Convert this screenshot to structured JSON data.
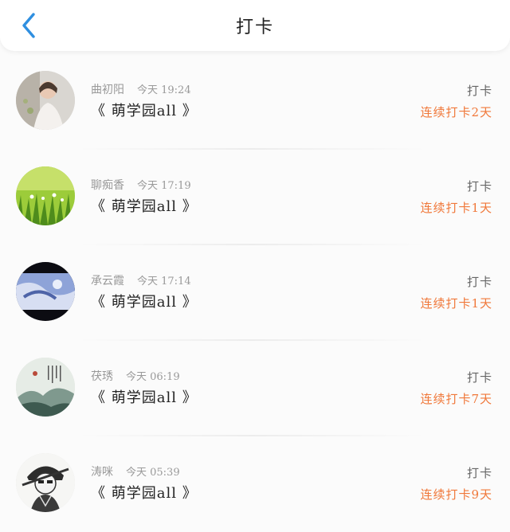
{
  "header": {
    "title": "打卡",
    "back_icon": "chevron-left-icon",
    "accent_color": "#2f8fe0"
  },
  "items": [
    {
      "name": "曲初阳",
      "time": "今天 19:24",
      "book": "《 萌学园all 》",
      "type": "打卡",
      "streak": "连续打卡2天",
      "avatar": "portrait-photo"
    },
    {
      "name": "聊痴香",
      "time": "今天 17:19",
      "book": "《 萌学园all 》",
      "type": "打卡",
      "streak": "连续打卡1天",
      "avatar": "grass-photo"
    },
    {
      "name": "承云霞",
      "time": "今天 17:14",
      "book": "《 萌学园all 》",
      "type": "打卡",
      "streak": "连续打卡1天",
      "avatar": "blue-art"
    },
    {
      "name": "茯琇",
      "time": "今天 06:19",
      "book": "《 萌学园all 》",
      "type": "打卡",
      "streak": "连续打卡7天",
      "avatar": "ink-landscape"
    },
    {
      "name": "涛咪",
      "time": "今天 05:39",
      "book": "《 萌学园all 》",
      "type": "打卡",
      "streak": "连续打卡9天",
      "avatar": "anime-sketch"
    }
  ],
  "colors": {
    "streak": "#f0783a",
    "name": "#999999",
    "book": "#222222"
  }
}
